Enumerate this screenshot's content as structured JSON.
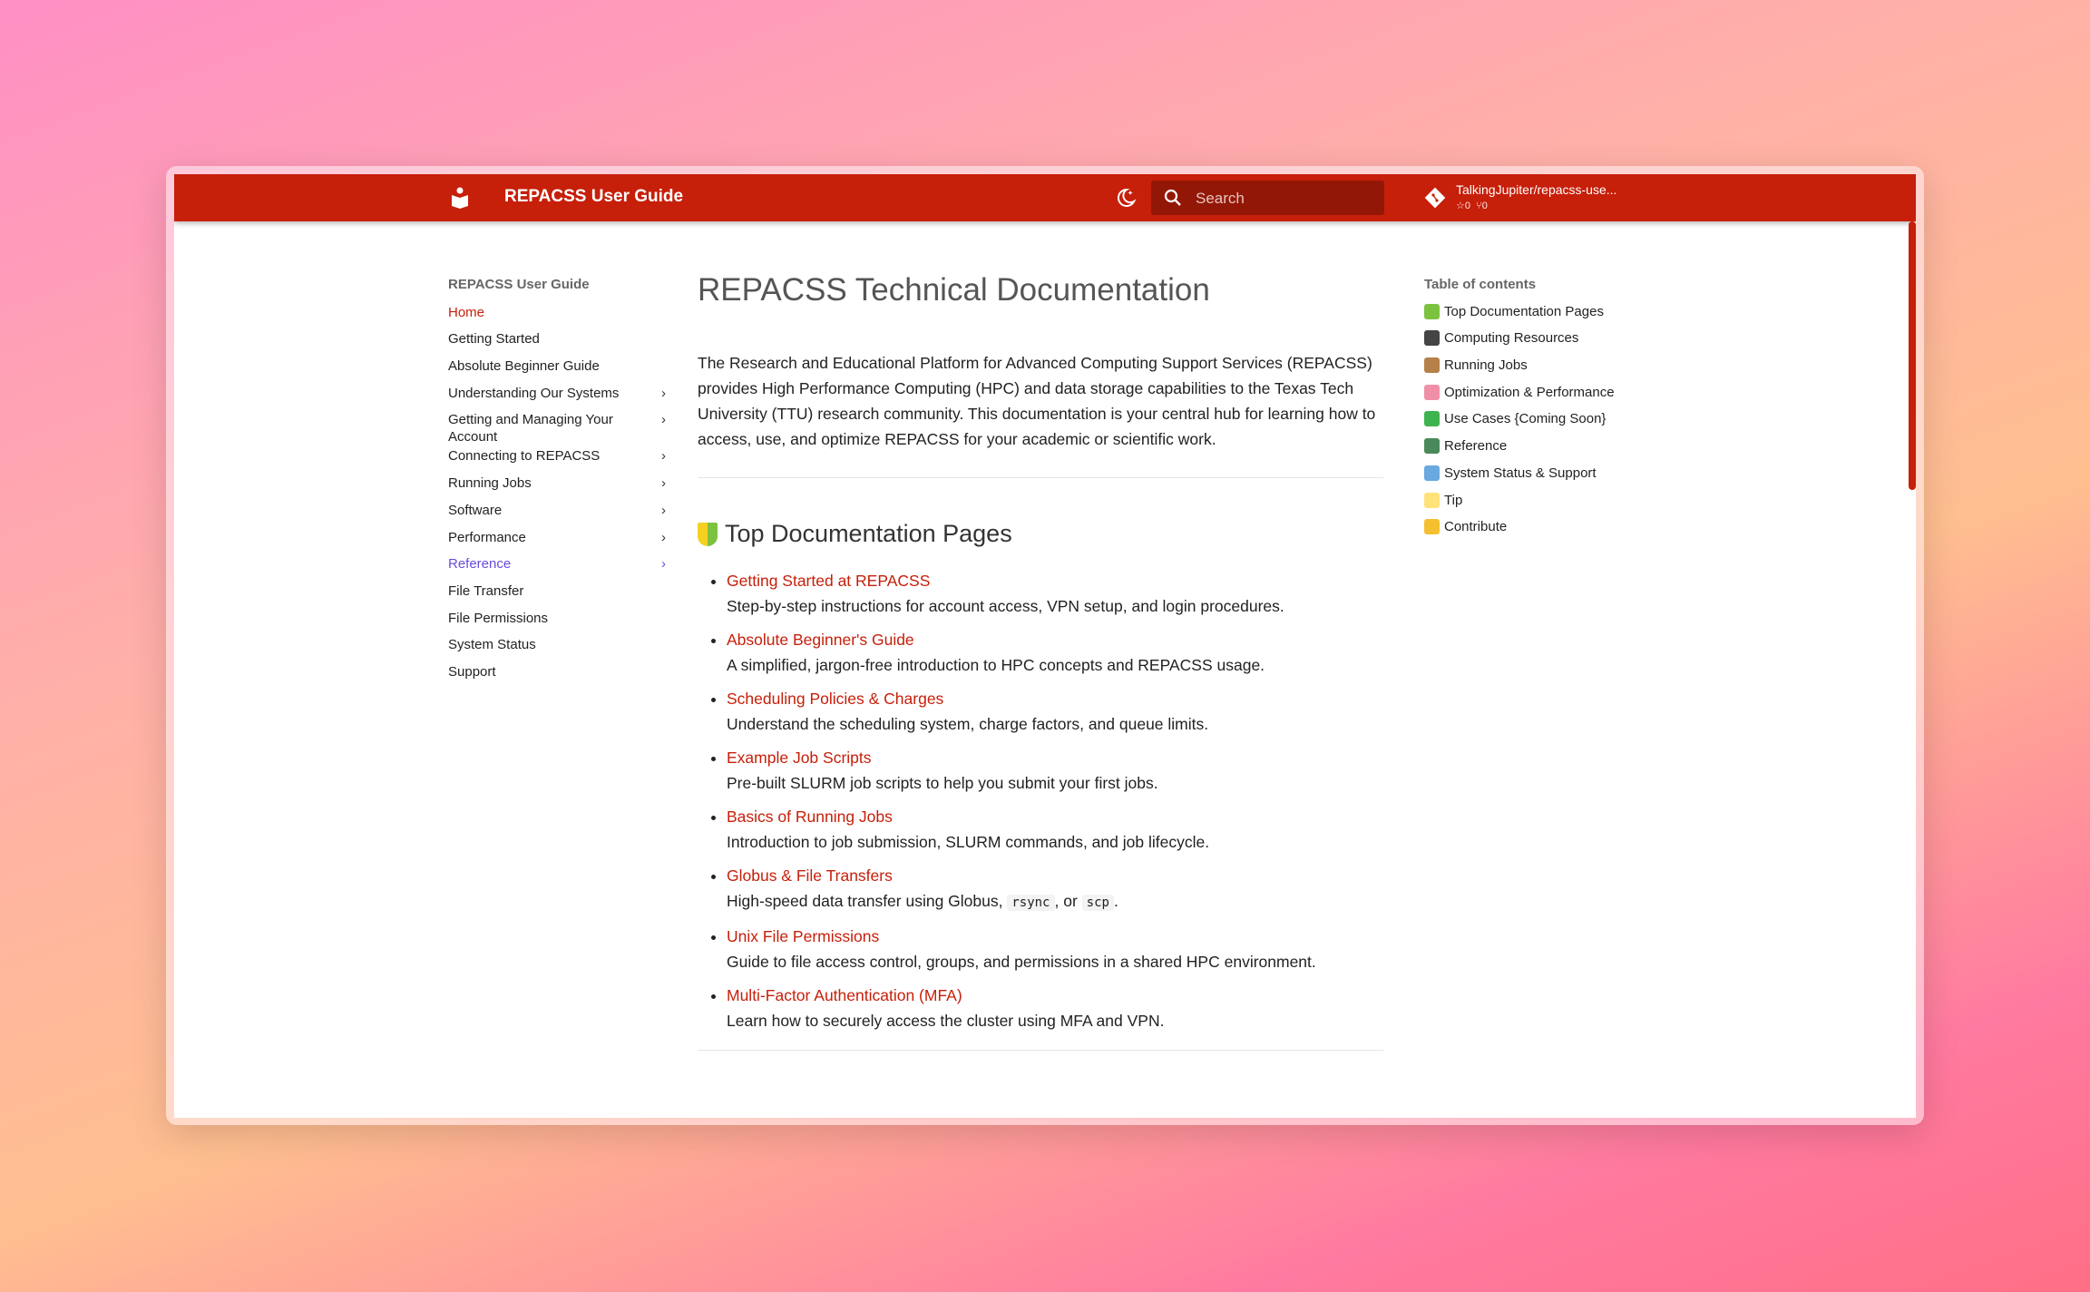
{
  "header": {
    "title": "REPACSS User Guide",
    "search_placeholder": "Search",
    "repo": "TalkingJupiter/repacss-use...",
    "stars": "0",
    "forks": "0",
    "brand_color": "#c61f0a"
  },
  "nav": {
    "heading": "REPACSS User Guide",
    "items": [
      {
        "label": "Home",
        "state": "active"
      },
      {
        "label": "Getting Started"
      },
      {
        "label": "Absolute Beginner Guide"
      },
      {
        "label": "Understanding Our Systems",
        "expandable": true
      },
      {
        "label": "Getting and Managing Your Account",
        "expandable": true
      },
      {
        "label": "Connecting to REPACSS",
        "expandable": true
      },
      {
        "label": "Running Jobs",
        "expandable": true
      },
      {
        "label": "Software",
        "expandable": true
      },
      {
        "label": "Performance",
        "expandable": true
      },
      {
        "label": "Reference",
        "expandable": true,
        "state": "hover"
      },
      {
        "label": "File Transfer"
      },
      {
        "label": "File Permissions"
      },
      {
        "label": "System Status"
      },
      {
        "label": "Support"
      }
    ]
  },
  "main": {
    "title": "REPACSS Technical Documentation",
    "intro": "The Research and Educational Platform for Advanced Computing Support Services (REPACSS) provides High Performance Computing (HPC) and data storage capabilities to the Texas Tech University (TTU) research community. This documentation is your central hub for learning how to access, use, and optimize REPACSS for your academic or scientific work.",
    "section_title": "Top Documentation Pages",
    "links": [
      {
        "title": "Getting Started at REPACSS",
        "desc": "Step-by-step instructions for account access, VPN setup, and login procedures."
      },
      {
        "title": "Absolute Beginner's Guide",
        "desc": "A simplified, jargon-free introduction to HPC concepts and REPACSS usage."
      },
      {
        "title": "Scheduling Policies & Charges",
        "desc": "Understand the scheduling system, charge factors, and queue limits."
      },
      {
        "title": "Example Job Scripts",
        "desc": "Pre-built SLURM job scripts to help you submit your first jobs."
      },
      {
        "title": "Basics of Running Jobs",
        "desc": "Introduction to job submission, SLURM commands, and job lifecycle."
      },
      {
        "title": "Globus & File Transfers",
        "desc": "High-speed data transfer using Globus, ",
        "code1": "rsync",
        "mid": ", or ",
        "code2": "scp",
        "end": "."
      },
      {
        "title": "Unix File Permissions",
        "desc": "Guide to file access control, groups, and permissions in a shared HPC environment."
      },
      {
        "title": "Multi-Factor Authentication (MFA)",
        "desc": "Learn how to securely access the cluster using MFA and VPN."
      }
    ]
  },
  "toc": {
    "heading": "Table of contents",
    "items": [
      {
        "label": "Top Documentation Pages",
        "icon": "beginner-icon",
        "color": "#7cc23f"
      },
      {
        "label": "Computing Resources",
        "icon": "laptop-icon",
        "color": "#444"
      },
      {
        "label": "Running Jobs",
        "icon": "package-icon",
        "color": "#b5804a"
      },
      {
        "label": "Optimization & Performance",
        "icon": "brain-icon",
        "color": "#f08fa8"
      },
      {
        "label": "Use Cases {Coming Soon}",
        "icon": "test-tube-icon",
        "color": "#3fb34f"
      },
      {
        "label": "Reference",
        "icon": "books-icon",
        "color": "#4a8a5a"
      },
      {
        "label": "System Status & Support",
        "icon": "globe-icon",
        "color": "#6aa8e0"
      },
      {
        "label": "Tip",
        "icon": "lightbulb-icon",
        "color": "#ffe27a"
      },
      {
        "label": "Contribute",
        "icon": "handshake-icon",
        "color": "#f5c030"
      }
    ]
  }
}
